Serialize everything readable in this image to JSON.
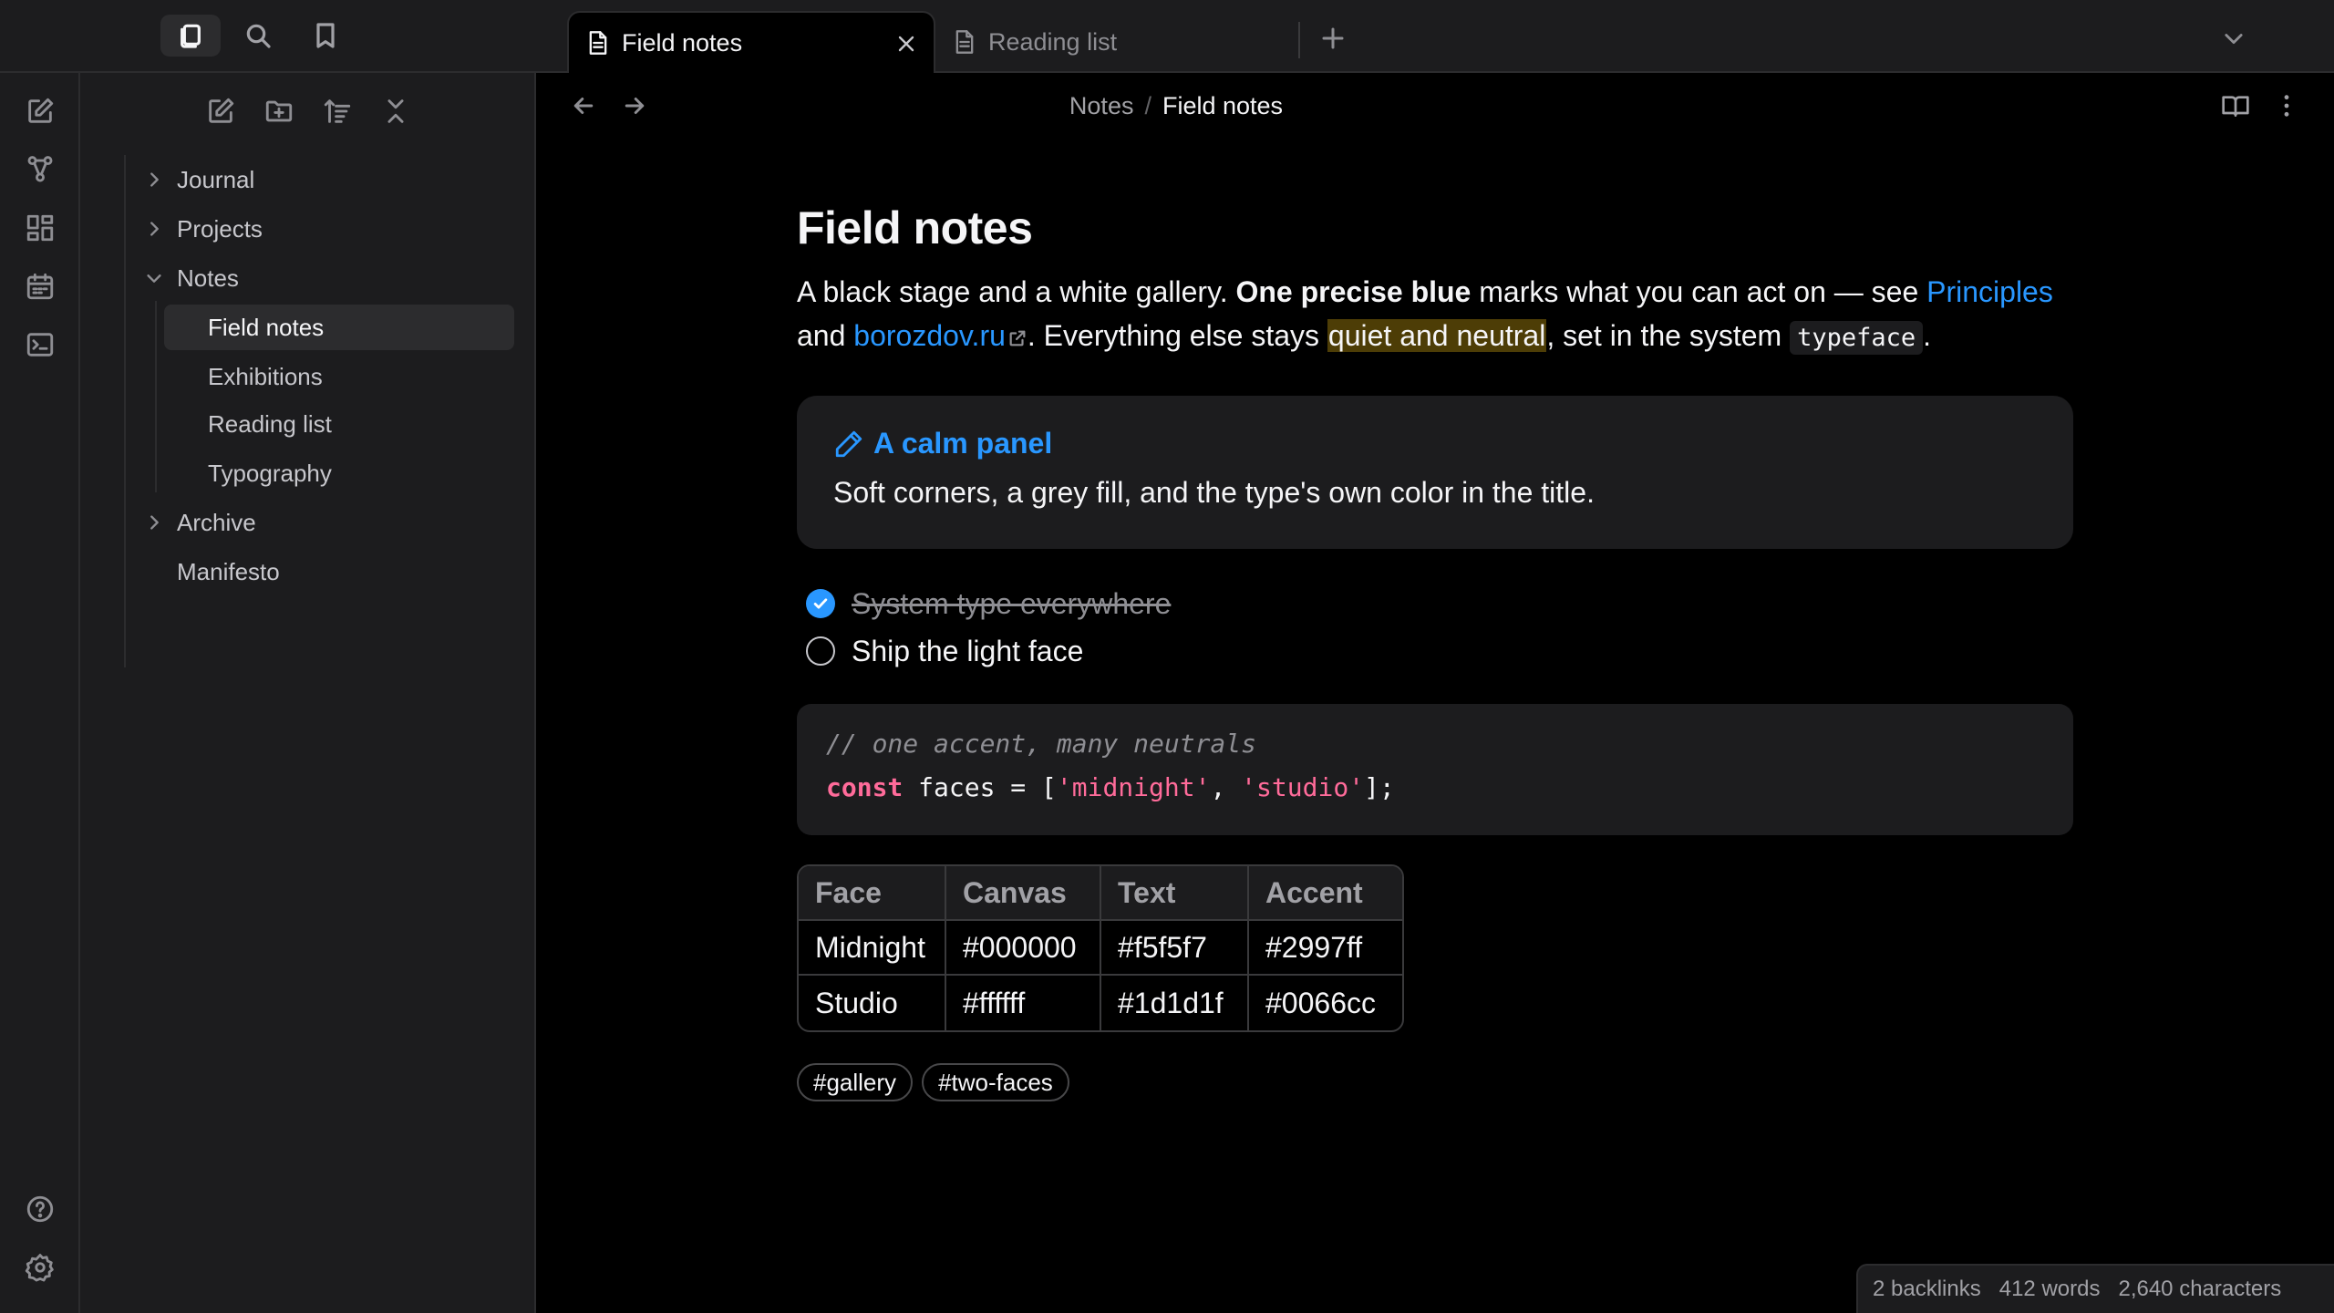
{
  "topbar": {
    "buttons": [
      {
        "icon": "files-icon",
        "active": true
      },
      {
        "icon": "search-icon"
      },
      {
        "icon": "bookmark-icon"
      }
    ],
    "tabs": [
      {
        "label": "Field notes",
        "active": true
      },
      {
        "label": "Reading list",
        "active": false
      }
    ]
  },
  "ribbon": {
    "items": [
      "new-note-icon",
      "graph-icon",
      "canvas-icon",
      "calendar-icon",
      "terminal-icon"
    ],
    "bottom": [
      "help-icon",
      "settings-icon"
    ]
  },
  "sidebar": {
    "toolbar": [
      "new-note-icon",
      "new-folder-icon",
      "sort-icon",
      "collapse-all-icon"
    ],
    "tree": [
      {
        "label": "Journal",
        "type": "folder",
        "expanded": false
      },
      {
        "label": "Projects",
        "type": "folder",
        "expanded": false
      },
      {
        "label": "Notes",
        "type": "folder",
        "expanded": true,
        "children": [
          {
            "label": "Field notes",
            "selected": true
          },
          {
            "label": "Exhibitions"
          },
          {
            "label": "Reading list"
          },
          {
            "label": "Typography"
          }
        ]
      },
      {
        "label": "Archive",
        "type": "folder",
        "expanded": false
      },
      {
        "label": "Manifesto",
        "type": "file"
      }
    ]
  },
  "view_header": {
    "breadcrumb_parent": "Notes",
    "breadcrumb_sep": "/",
    "breadcrumb_current": "Field notes"
  },
  "document": {
    "title": "Field notes",
    "intro": {
      "t1": "A black stage and a white gallery. ",
      "bold": "One precise blue",
      "t2": " marks what you can act on — see ",
      "link1": "Principles",
      "t3": " and ",
      "link2": "borozdov.ru",
      "t4": ". Everything else stays ",
      "highlight": "quiet and neutral",
      "t5": ", set in the system ",
      "code": "typeface",
      "t6": "."
    },
    "callout": {
      "title": "A calm panel",
      "body": "Soft corners, a grey fill, and the type's own color in the title."
    },
    "tasks": [
      {
        "label": "System type everywhere",
        "done": true
      },
      {
        "label": "Ship the light face",
        "done": false
      }
    ],
    "code": {
      "comment": "// one accent, many neutrals",
      "keyword": "const",
      "p1": " faces = [",
      "s1": "'midnight'",
      "p2": ", ",
      "s2": "'studio'",
      "p3": "];"
    },
    "table": {
      "headers": [
        "Face",
        "Canvas",
        "Text",
        "Accent"
      ],
      "rows": [
        [
          "Midnight",
          "#000000",
          "#f5f5f7",
          "#2997ff"
        ],
        [
          "Studio",
          "#ffffff",
          "#1d1d1f",
          "#0066cc"
        ]
      ]
    },
    "tags": [
      "#gallery",
      "#two-faces"
    ]
  },
  "status": {
    "backlinks": "2 backlinks",
    "words": "412 words",
    "characters": "2,640 characters"
  },
  "colors": {
    "accent": "#2997ff",
    "background": "#000000",
    "panel": "#1c1c1e",
    "text": "#f5f5f7"
  }
}
